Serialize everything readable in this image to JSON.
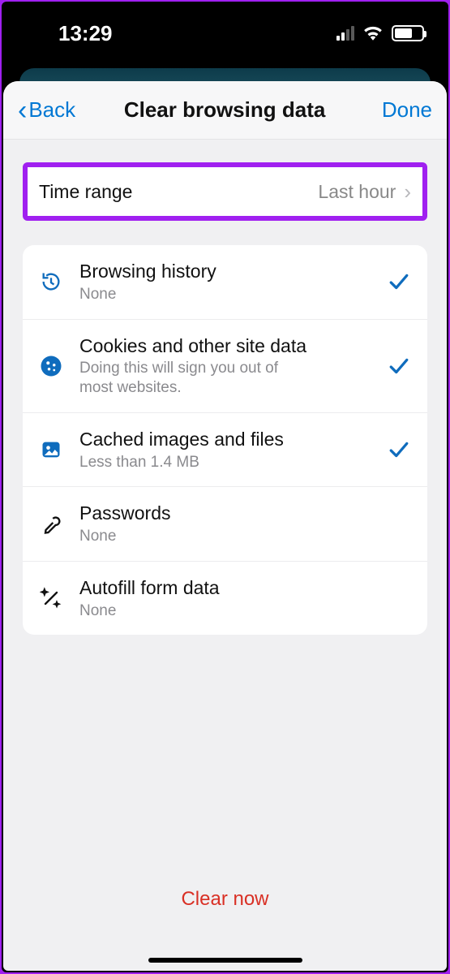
{
  "status_bar": {
    "time": "13:29"
  },
  "nav": {
    "back_label": "Back",
    "title": "Clear browsing data",
    "done_label": "Done"
  },
  "time_range": {
    "label": "Time range",
    "value": "Last hour"
  },
  "items": [
    {
      "title": "Browsing history",
      "subtitle": "None",
      "checked": true,
      "icon": "history"
    },
    {
      "title": "Cookies and other site data",
      "subtitle": "Doing this will sign you out of most websites.",
      "checked": true,
      "icon": "cookie"
    },
    {
      "title": "Cached images and files",
      "subtitle": "Less than 1.4 MB",
      "checked": true,
      "icon": "image"
    },
    {
      "title": "Passwords",
      "subtitle": "None",
      "checked": false,
      "icon": "key"
    },
    {
      "title": "Autofill form data",
      "subtitle": "None",
      "checked": false,
      "icon": "wand"
    }
  ],
  "footer": {
    "clear_now": "Clear now"
  },
  "colors": {
    "accent_blue": "#0078d4",
    "destructive_red": "#d93025",
    "highlight_purple": "#a020f0"
  }
}
